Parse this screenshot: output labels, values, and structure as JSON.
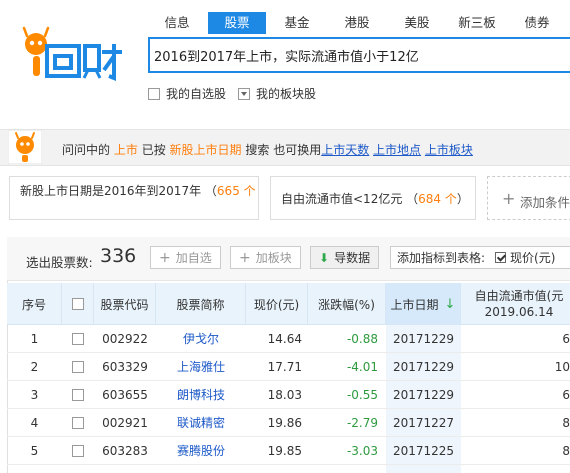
{
  "brand": {
    "logo_text": "问财",
    "accent": "#1e88e5",
    "orange": "#ff7f0e"
  },
  "nav": {
    "items": [
      {
        "label": "信息"
      },
      {
        "label": "股票"
      },
      {
        "label": "基金"
      },
      {
        "label": "港股"
      },
      {
        "label": "美股"
      },
      {
        "label": "新三板"
      },
      {
        "label": "债券"
      }
    ],
    "active_index": 1
  },
  "search": {
    "value": "2016到2017年上市，实际流通市值小于12亿"
  },
  "filters": {
    "my_stocks": "我的自选股",
    "my_sectors": "我的板块股"
  },
  "bot": {
    "t1": "问问中的",
    "t2": "上市",
    "t3": "已按",
    "t4": "新股上市日期",
    "t5": "搜索   也可换用",
    "link1": "上市天数",
    "link2": "上市地点",
    "link3": "上市板块"
  },
  "conditions": [
    {
      "line1": "新股上市日期是2016年到2017年",
      "count": "665 个",
      "line2": ""
    },
    {
      "line1": "自由流通市值<12亿元",
      "count": "684 个",
      "line2": ""
    }
  ],
  "add_condition": "添加条件",
  "toolbar": {
    "count_label": "选出股票数:",
    "count": "336",
    "add_watch": "加自选",
    "add_sector": "加板块",
    "export": "导数据",
    "add_col_label": "添加指标到表格:",
    "add_col_item": "现价(元)"
  },
  "table": {
    "headers": {
      "seq": "序号",
      "code": "股票代码",
      "name": "股票简称",
      "price": "现价(元)",
      "change": "涨跌幅(%)",
      "date": "上市日期",
      "float_cap": "自由流通市值(元",
      "float_cap_date": "2019.06.14"
    },
    "rows": [
      {
        "seq": "1",
        "code": "002922",
        "name": "伊戈尔",
        "price": "14.64",
        "change": "-0.88",
        "date": "20171229",
        "cap": "6"
      },
      {
        "seq": "2",
        "code": "603329",
        "name": "上海雅仕",
        "price": "17.71",
        "change": "-4.01",
        "date": "20171229",
        "cap": "10"
      },
      {
        "seq": "3",
        "code": "603655",
        "name": "朗博科技",
        "price": "18.03",
        "change": "-0.55",
        "date": "20171229",
        "cap": "6"
      },
      {
        "seq": "4",
        "code": "002921",
        "name": "联诚精密",
        "price": "19.86",
        "change": "-2.79",
        "date": "20171227",
        "cap": "8"
      },
      {
        "seq": "5",
        "code": "603283",
        "name": "赛腾股份",
        "price": "19.85",
        "change": "-3.03",
        "date": "20171225",
        "cap": "8"
      }
    ]
  }
}
